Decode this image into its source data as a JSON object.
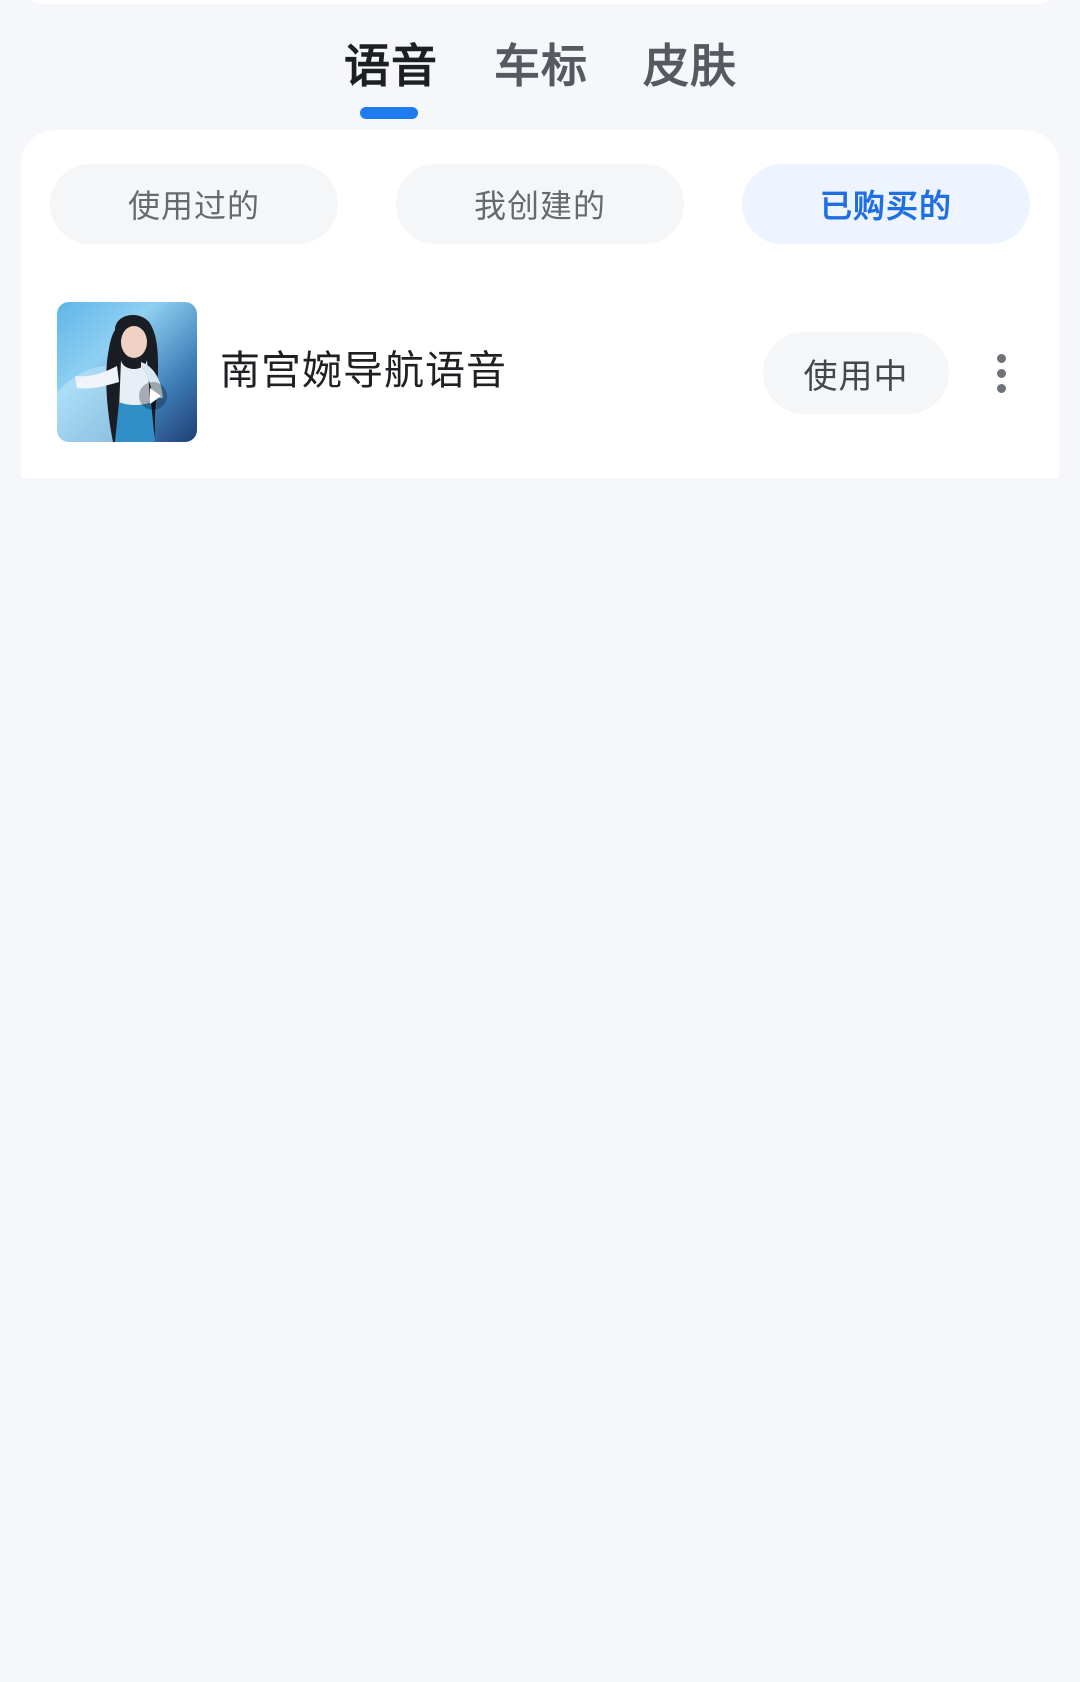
{
  "top_tabs": {
    "items": [
      {
        "label": "语音",
        "active": true
      },
      {
        "label": "车标",
        "active": false
      },
      {
        "label": "皮肤",
        "active": false
      }
    ],
    "indicator_color": "#1f7cf0"
  },
  "filters": [
    {
      "label": "使用过的",
      "active": false
    },
    {
      "label": "我创建的",
      "active": false
    },
    {
      "label": "已购买的",
      "active": true
    }
  ],
  "voice_list": [
    {
      "name": "南宫婉导航语音",
      "status_label": "使用中",
      "thumbnail": "character-portrait-image",
      "play_icon": "play-icon",
      "more_icon": "more-vertical-icon"
    }
  ],
  "colors": {
    "accent": "#1f6fe3",
    "background": "#f6f7fb",
    "card": "#ffffff"
  }
}
